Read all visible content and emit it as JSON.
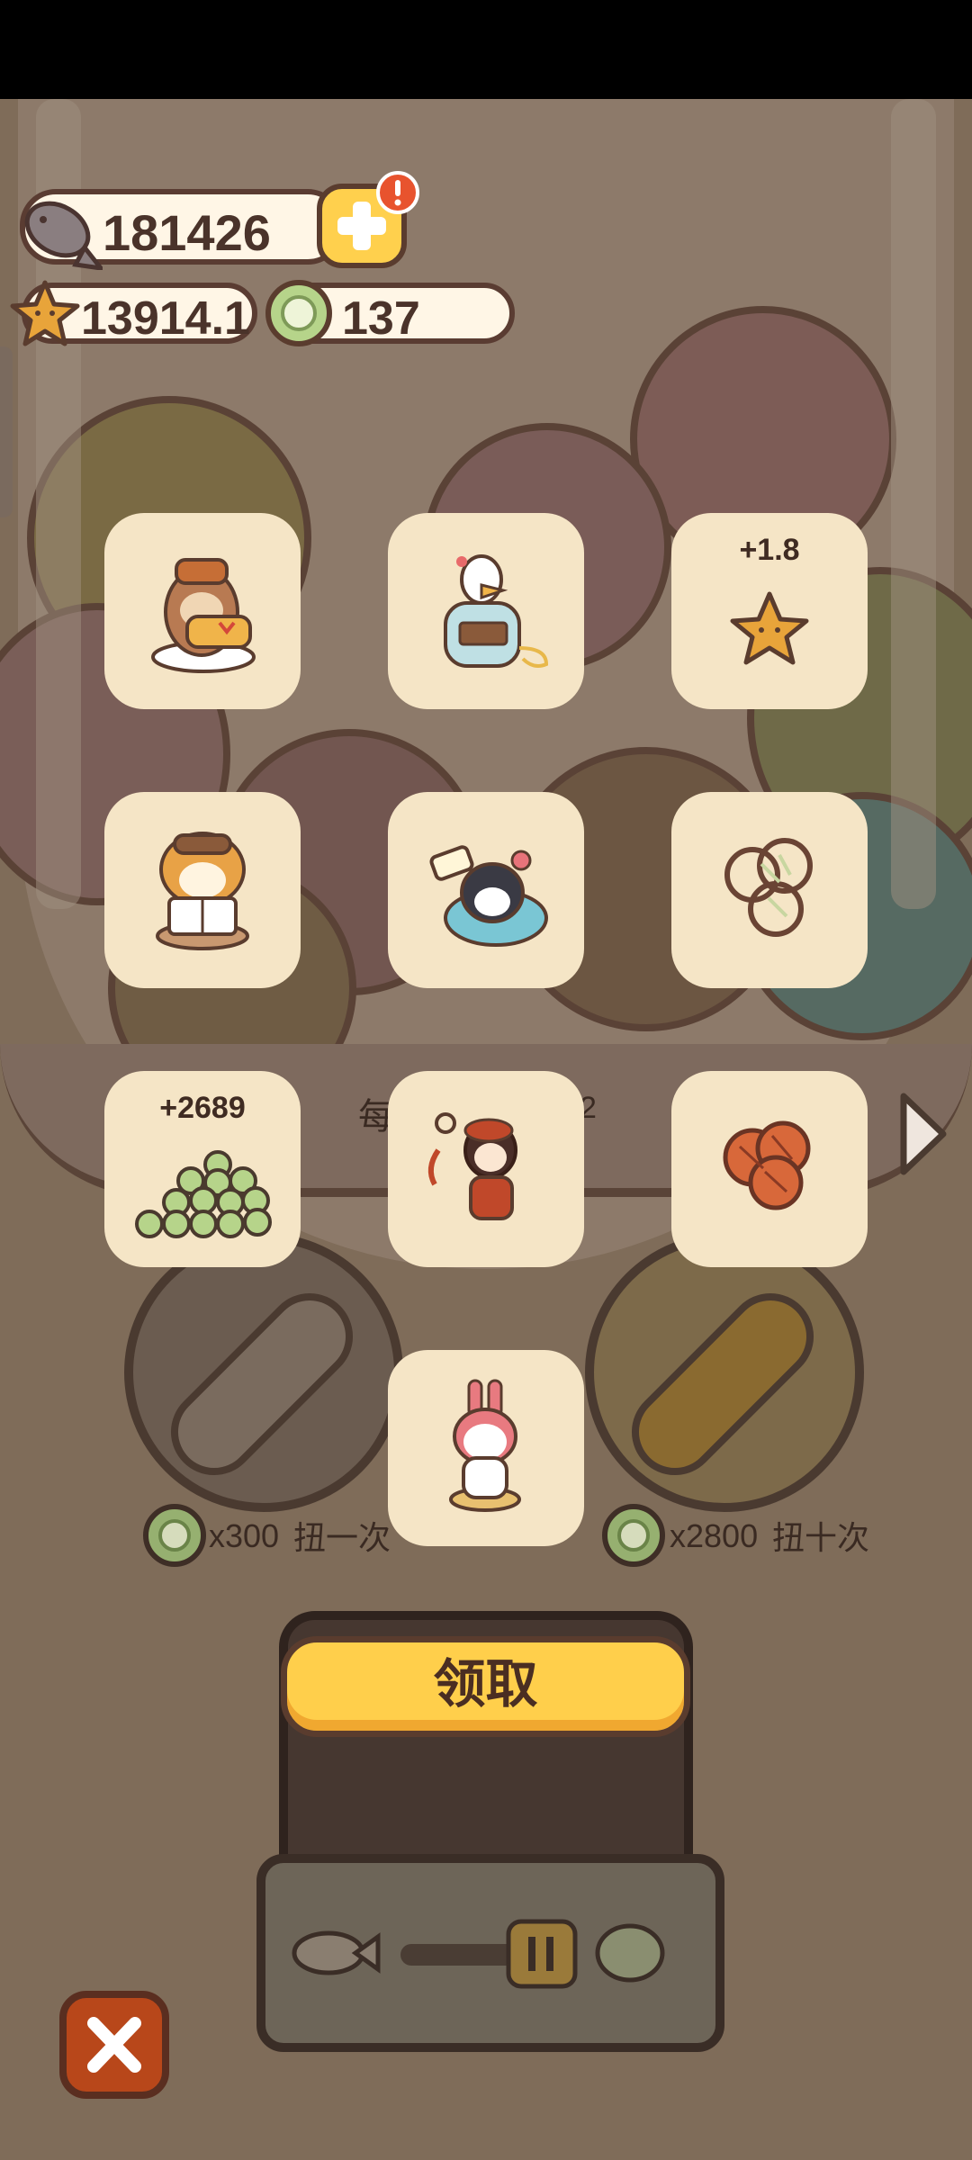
{
  "currencies": {
    "fish": "181426",
    "star": "13914.1",
    "coin": "137"
  },
  "grid": {
    "items": [
      {
        "name": "otter-with-gift",
        "label": ""
      },
      {
        "name": "duck-in-kimono",
        "label": ""
      },
      {
        "name": "star-reward",
        "label": "+1.8"
      },
      {
        "name": "shiba-reading-book",
        "label": ""
      },
      {
        "name": "penguin-in-tub",
        "label": ""
      },
      {
        "name": "melon-slices",
        "label": ""
      },
      {
        "name": "coin-pile",
        "label": "+2689"
      },
      {
        "name": "girl-with-keys",
        "label": ""
      },
      {
        "name": "orange-balls",
        "label": ""
      },
      {
        "name": "bunny-hood-cat",
        "label": ""
      }
    ]
  },
  "behind_text": {
    "left_char": "每",
    "right_char": "2"
  },
  "gacha": {
    "single": {
      "cost": "x300",
      "label": "扭一次"
    },
    "ten": {
      "cost": "x2800",
      "label": "扭十次"
    }
  },
  "claim_button": "领取",
  "colors": {
    "cell_bg": "#f5e5c6",
    "claim_btn": "#ffcf4b",
    "close_btn": "#b8471a",
    "overlay_bg": "#7f6c59"
  },
  "icons": [
    "fish-icon",
    "plus-icon",
    "alert-icon",
    "star-icon",
    "coin-icon",
    "close-icon",
    "arrow-right-icon",
    "pause-icon"
  ]
}
